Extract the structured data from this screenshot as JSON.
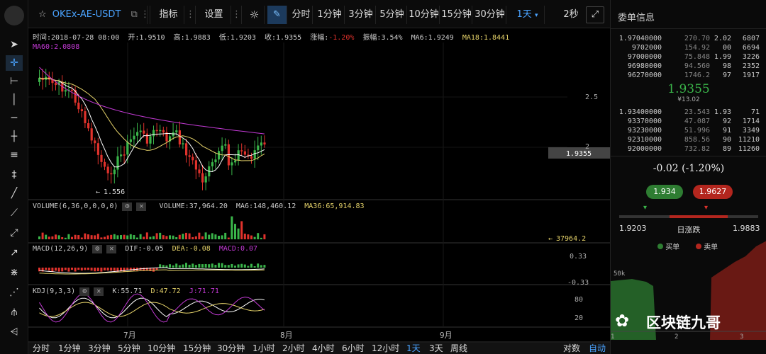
{
  "toolbar": {
    "symbol": "OKEx-AE-USDT",
    "indicators_label": "指标",
    "settings_label": "设置",
    "periods": [
      "分时",
      "1分钟",
      "3分钟",
      "5分钟",
      "10分钟",
      "15分钟",
      "30分钟"
    ],
    "period_selected": "1天",
    "refresh": "2秒"
  },
  "info": {
    "time": "时间:2018-07-28 08:00",
    "open": "开:1.9510",
    "high": "高:1.9883",
    "low": "低:1.9203",
    "close": "收:1.9355",
    "change_label": "涨幅:",
    "change_value": "-1.20%",
    "amplitude": "振幅:3.54%",
    "ma6": "MA6:1.9249",
    "ma18": "MA18:1.8441",
    "ma60": "MA60:2.0808"
  },
  "price_axis": {
    "tick_25": "2.5",
    "tick_2": "2",
    "current_price": "1.9355",
    "low_marker": "1.556"
  },
  "volume": {
    "title": "VOLUME(6,36,0,0,0,0)",
    "volume": "VOLUME:37,964.20",
    "ma6": "MA6:148,460.12",
    "ma36": "MA36:65,914.83",
    "last": "37964.2"
  },
  "macd": {
    "title": "MACD(12,26,9)",
    "dif": "DIF:-0.05",
    "dea": "DEA:-0.08",
    "macd": "MACD:0.07",
    "tick_top": "0.33",
    "tick_bottom": "-0.33"
  },
  "kdj": {
    "title": "KDJ(9,3,3)",
    "k": "K:55.71",
    "d": "D:47.72",
    "j": "J:71.71",
    "tick_80": "80",
    "tick_20": "20"
  },
  "time_axis": {
    "jul": "7月",
    "aug": "8月",
    "sep": "9月"
  },
  "bottom": {
    "periods": [
      "分时",
      "1分钟",
      "3分钟",
      "5分钟",
      "10分钟",
      "15分钟",
      "30分钟",
      "1小时",
      "2小时",
      "4小时",
      "6小时",
      "12小时"
    ],
    "day": "1天",
    "three_day": "3天",
    "week": "周线",
    "log": "对数",
    "auto": "自动"
  },
  "orderbook": {
    "title": "委单信息",
    "asks": [
      [
        "1.97040000",
        "270.70",
        "2.02",
        "6807"
      ],
      [
        "9702000",
        "154.92",
        "00",
        "6694"
      ],
      [
        "97000000",
        "75.848",
        "1.99",
        "3226"
      ],
      [
        "96980000",
        "94.560",
        "98",
        "2352"
      ],
      [
        "96270000",
        "1746.2",
        "97",
        "1917"
      ]
    ],
    "last_price": "1.9355",
    "last_cny": "¥13.02",
    "bids": [
      [
        "1.93400000",
        "23.543",
        "1.93",
        "71"
      ],
      [
        "93370000",
        "47.087",
        "92",
        "1714"
      ],
      [
        "93230000",
        "51.996",
        "91",
        "3349"
      ],
      [
        "92310000",
        "858.56",
        "90",
        "11210"
      ],
      [
        "92000000",
        "732.82",
        "89",
        "11260"
      ]
    ],
    "change": "-0.02 (-1.20%)",
    "buy_price": "1.934",
    "sell_price": "1.9627",
    "low": "1.9203",
    "range_label": "日涨跌",
    "high": "1.9883",
    "buy_label": "买单",
    "sell_label": "卖单",
    "depth_tick": "50k",
    "depth_axis": [
      "1",
      "2",
      "3"
    ],
    "watermark": "区块链九哥"
  },
  "colors": {
    "up": "#3ab54a",
    "down": "#e0322c",
    "accent": "#4aa3ff",
    "ma6": "#ffffff",
    "ma18": "#e6d36a",
    "ma60": "#c43ad6"
  }
}
